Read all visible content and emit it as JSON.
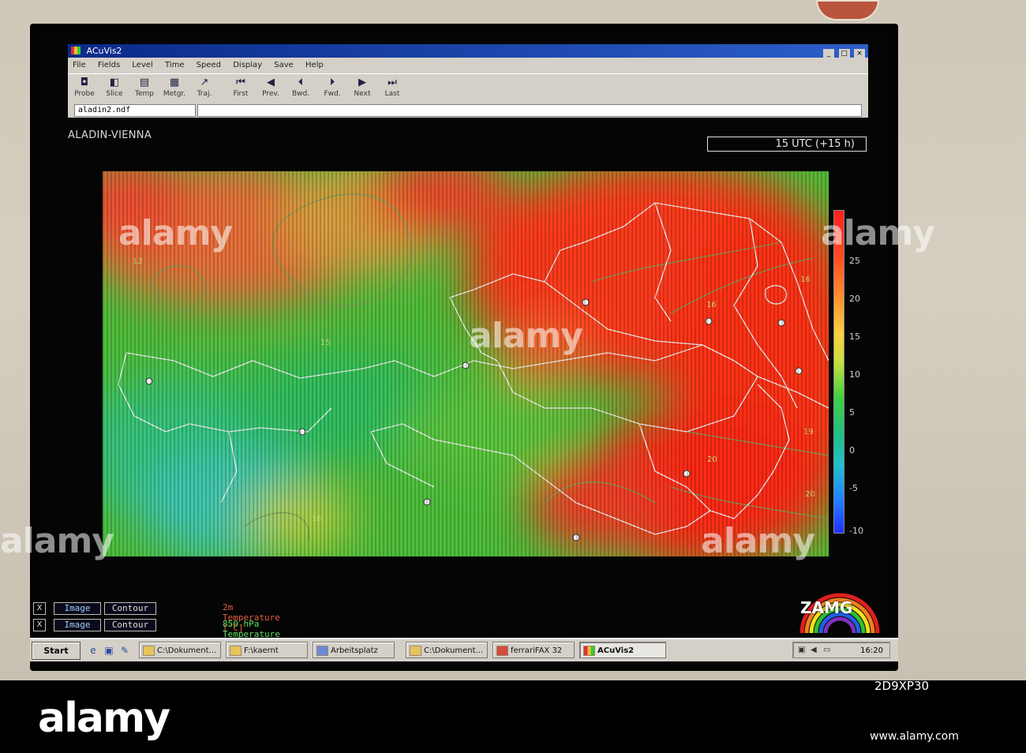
{
  "window": {
    "title": "ACuVis2",
    "controls": [
      "_",
      "□",
      "×"
    ]
  },
  "menubar": [
    "File",
    "Fields",
    "Level",
    "Time",
    "Speed",
    "Display",
    "Save",
    "Help"
  ],
  "toolbar": [
    {
      "label": "Probe",
      "icon": "probe-icon",
      "glyph": "◘"
    },
    {
      "label": "Slice",
      "icon": "slice-icon",
      "glyph": "◧"
    },
    {
      "label": "Temp",
      "icon": "thermometer-icon",
      "glyph": "▤"
    },
    {
      "label": "Metgr.",
      "icon": "meteogram-icon",
      "glyph": "▦"
    },
    {
      "label": "Traj.",
      "icon": "trajectory-icon",
      "glyph": "↗"
    },
    {
      "label": "First",
      "icon": "first-icon",
      "glyph": "⏮"
    },
    {
      "label": "Prev.",
      "icon": "previous-icon",
      "glyph": "◀"
    },
    {
      "label": "Bwd.",
      "icon": "backward-icon",
      "glyph": "⏴"
    },
    {
      "label": "Fwd.",
      "icon": "forward-icon",
      "glyph": "⏵"
    },
    {
      "label": "Next",
      "icon": "next-icon",
      "glyph": "▶"
    },
    {
      "label": "Last",
      "icon": "last-icon",
      "glyph": "⏭"
    }
  ],
  "file": {
    "name": "aladin2.ndf"
  },
  "panel": {
    "model": "ALADIN-VIENNA",
    "time": "15 UTC (+15 h)"
  },
  "colorbar": {
    "ticks": [
      "25",
      "20",
      "15",
      "10",
      "5",
      "0",
      "-5",
      "-10"
    ]
  },
  "map": {
    "contour_labels": [
      "12",
      "15",
      "16",
      "16",
      "19",
      "20",
      "20",
      "18"
    ]
  },
  "legend": [
    {
      "toggle": "X",
      "image": "Image",
      "contour": "Contour",
      "label": "2m Temperature [°C]",
      "color": "#e06040"
    },
    {
      "toggle": "X",
      "image": "Image",
      "contour": "Contour",
      "label": "850 hPa Temperature [°C]",
      "color": "#60e060"
    }
  ],
  "logo": {
    "text": "ZAMG"
  },
  "taskbar": {
    "start": "Start",
    "tasks": [
      {
        "label": "C:\\Dokument..."
      },
      {
        "label": "F:\\kaernt"
      },
      {
        "label": "Arbeitsplatz"
      },
      {
        "label": "C:\\Dokument..."
      },
      {
        "label": "ferrariFAX 32"
      },
      {
        "label": "ACuVis2",
        "active": true
      }
    ],
    "clock": "16:20"
  },
  "watermark": {
    "text": "alamy",
    "image_id": "2D9XP30",
    "url": "www.alamy.com"
  }
}
